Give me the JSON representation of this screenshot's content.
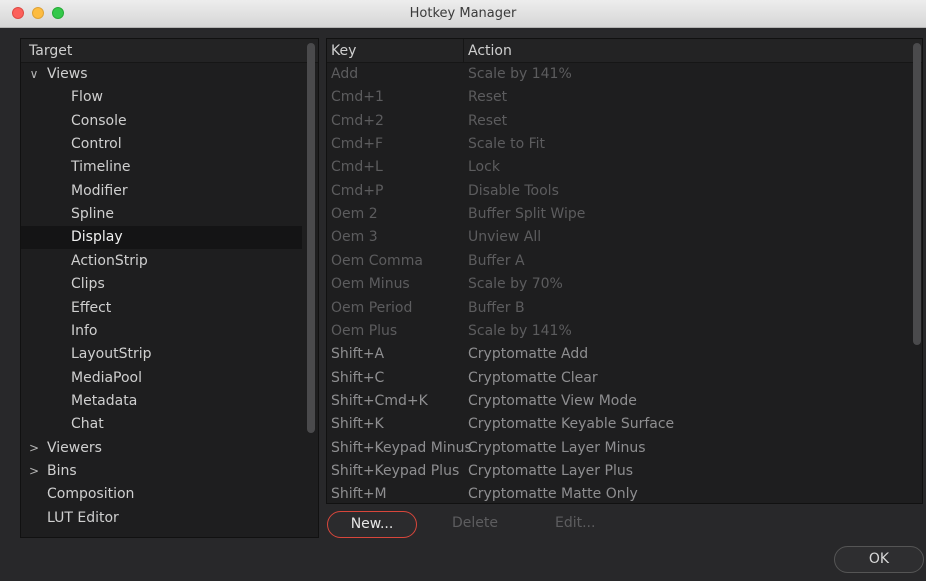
{
  "window": {
    "title": "Hotkey Manager"
  },
  "tree": {
    "header": "Target",
    "rows": [
      {
        "label": "Views",
        "chevron": "∨"
      },
      {
        "label": "Flow"
      },
      {
        "label": "Console"
      },
      {
        "label": "Control"
      },
      {
        "label": "Timeline"
      },
      {
        "label": "Modifier"
      },
      {
        "label": "Spline"
      },
      {
        "label": "Display",
        "selected": true
      },
      {
        "label": "ActionStrip"
      },
      {
        "label": "Clips"
      },
      {
        "label": "Effect"
      },
      {
        "label": "Info"
      },
      {
        "label": "LayoutStrip"
      },
      {
        "label": "MediaPool"
      },
      {
        "label": "Metadata"
      },
      {
        "label": "Chat"
      },
      {
        "label": "Viewers",
        "chevron": ">"
      },
      {
        "label": "Bins",
        "chevron": ">"
      },
      {
        "label": "Composition"
      },
      {
        "label": "LUT Editor"
      }
    ]
  },
  "table": {
    "columns": [
      "Key",
      "Action"
    ],
    "rows": [
      {
        "key": "Add",
        "action": "Scale by 141%"
      },
      {
        "key": "Cmd+1",
        "action": "Reset"
      },
      {
        "key": "Cmd+2",
        "action": "Reset"
      },
      {
        "key": "Cmd+F",
        "action": "Scale to Fit"
      },
      {
        "key": "Cmd+L",
        "action": "Lock"
      },
      {
        "key": "Cmd+P",
        "action": "Disable Tools"
      },
      {
        "key": "Oem 2",
        "action": "Buffer Split Wipe"
      },
      {
        "key": "Oem 3",
        "action": "Unview All"
      },
      {
        "key": "Oem Comma",
        "action": "Buffer A"
      },
      {
        "key": "Oem Minus",
        "action": "Scale by 70%"
      },
      {
        "key": "Oem Period",
        "action": "Buffer B"
      },
      {
        "key": "Oem Plus",
        "action": "Scale by 141%"
      },
      {
        "key": "Shift+A",
        "action": "Cryptomatte Add"
      },
      {
        "key": "Shift+C",
        "action": "Cryptomatte Clear"
      },
      {
        "key": "Shift+Cmd+K",
        "action": "Cryptomatte View Mode"
      },
      {
        "key": "Shift+K",
        "action": "Cryptomatte Keyable Surface"
      },
      {
        "key": "Shift+Keypad Minus",
        "action": "Cryptomatte Layer Minus"
      },
      {
        "key": "Shift+Keypad Plus",
        "action": "Cryptomatte Layer Plus"
      },
      {
        "key": "Shift+M",
        "action": "Cryptomatte Matte Only"
      }
    ]
  },
  "buttons": {
    "new": "New...",
    "delete": "Delete",
    "edit": "Edit...",
    "ok": "OK"
  },
  "colors": {
    "accent": "#d8463b",
    "background": "#28282a",
    "panel": "#1e1e1f"
  }
}
